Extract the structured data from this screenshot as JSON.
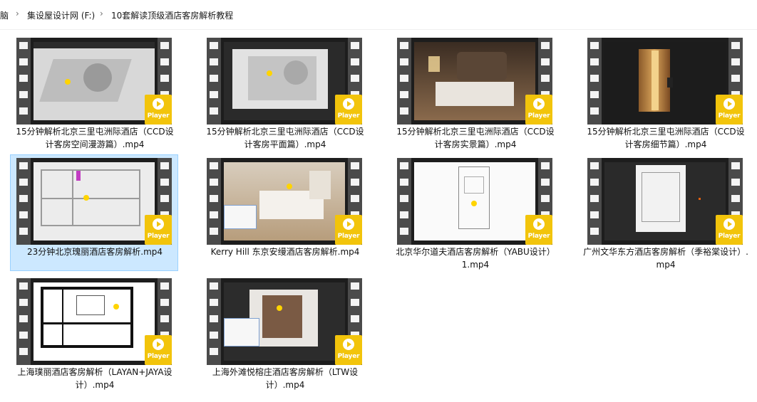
{
  "breadcrumb": {
    "items": [
      "脑",
      "集设屋设计网 (F:)",
      "10套解读顶级酒店客房解析教程"
    ],
    "separator": "›"
  },
  "badge_label": "Player",
  "icons": {
    "play_badge": "play-icon",
    "separator": "chevron-right-icon"
  },
  "colors": {
    "badge": "#f2c40b",
    "selection_bg": "#cce8ff",
    "selection_border": "#99d1ff",
    "film_strip": "#4b4b4b"
  },
  "files": [
    {
      "name": "15分钟解析北京三里屯洲际酒店（CCD设计客房空间漫游篇）.mp4",
      "selected": false
    },
    {
      "name": "15分钟解析北京三里屯洲际酒店（CCD设计客房平面篇）.mp4",
      "selected": false
    },
    {
      "name": "15分钟解析北京三里屯洲际酒店（CCD设计客房实景篇）.mp4",
      "selected": false
    },
    {
      "name": "15分钟解析北京三里屯洲际酒店（CCD设计客房细节篇）.mp4",
      "selected": false
    },
    {
      "name": "23分钟北京瑰丽酒店客房解析.mp4",
      "selected": true
    },
    {
      "name": "Kerry Hill 东京安缦酒店客房解析.mp4",
      "selected": false
    },
    {
      "name": "北京华尔道夫酒店客房解析（YABU设计）1.mp4",
      "selected": false
    },
    {
      "name": "广州文华东方酒店客房解析（季裕棠设计）.mp4",
      "selected": false
    },
    {
      "name": "上海璞丽酒店客房解析（LAYAN+JAYA设计）.mp4",
      "selected": false
    },
    {
      "name": "上海外滩悦榕庄酒店客房解析（LTW设计）.mp4",
      "selected": false
    }
  ]
}
